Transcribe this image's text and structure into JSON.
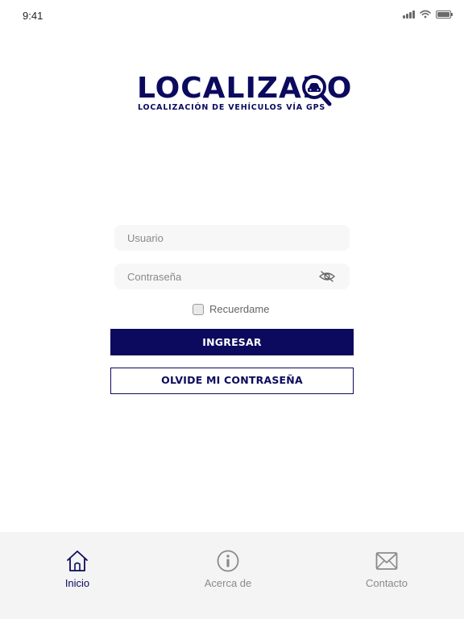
{
  "status_bar": {
    "time": "9:41",
    "icons": [
      "signal-icon",
      "wifi-icon",
      "battery-icon"
    ]
  },
  "logo": {
    "wordmark": "LOCALIZADO",
    "tagline": "LOCALIZACIÓN DE VEHÍCULOS VÍA GPS"
  },
  "login_form": {
    "username_placeholder": "Usuario",
    "username_value": "",
    "password_placeholder": "Contraseña",
    "password_value": "",
    "password_toggle_icon": "eye-slash-icon",
    "remember_label": "Recuerdame",
    "remember_checked": false,
    "submit_label": "INGRESAR",
    "forgot_label": "OLVIDE MI CONTRASEÑA"
  },
  "tab_bar": {
    "tabs": [
      {
        "label": "Inicio",
        "icon": "home-icon",
        "active": true
      },
      {
        "label": "Acerca de",
        "icon": "info-icon",
        "active": false
      },
      {
        "label": "Contacto",
        "icon": "mail-icon",
        "active": false
      }
    ]
  },
  "colors": {
    "brand": "#0b0a5e",
    "tabbar_background": "#f4f4f4",
    "field_background": "#f7f7f7",
    "inactive_text": "#8a8a8a"
  }
}
